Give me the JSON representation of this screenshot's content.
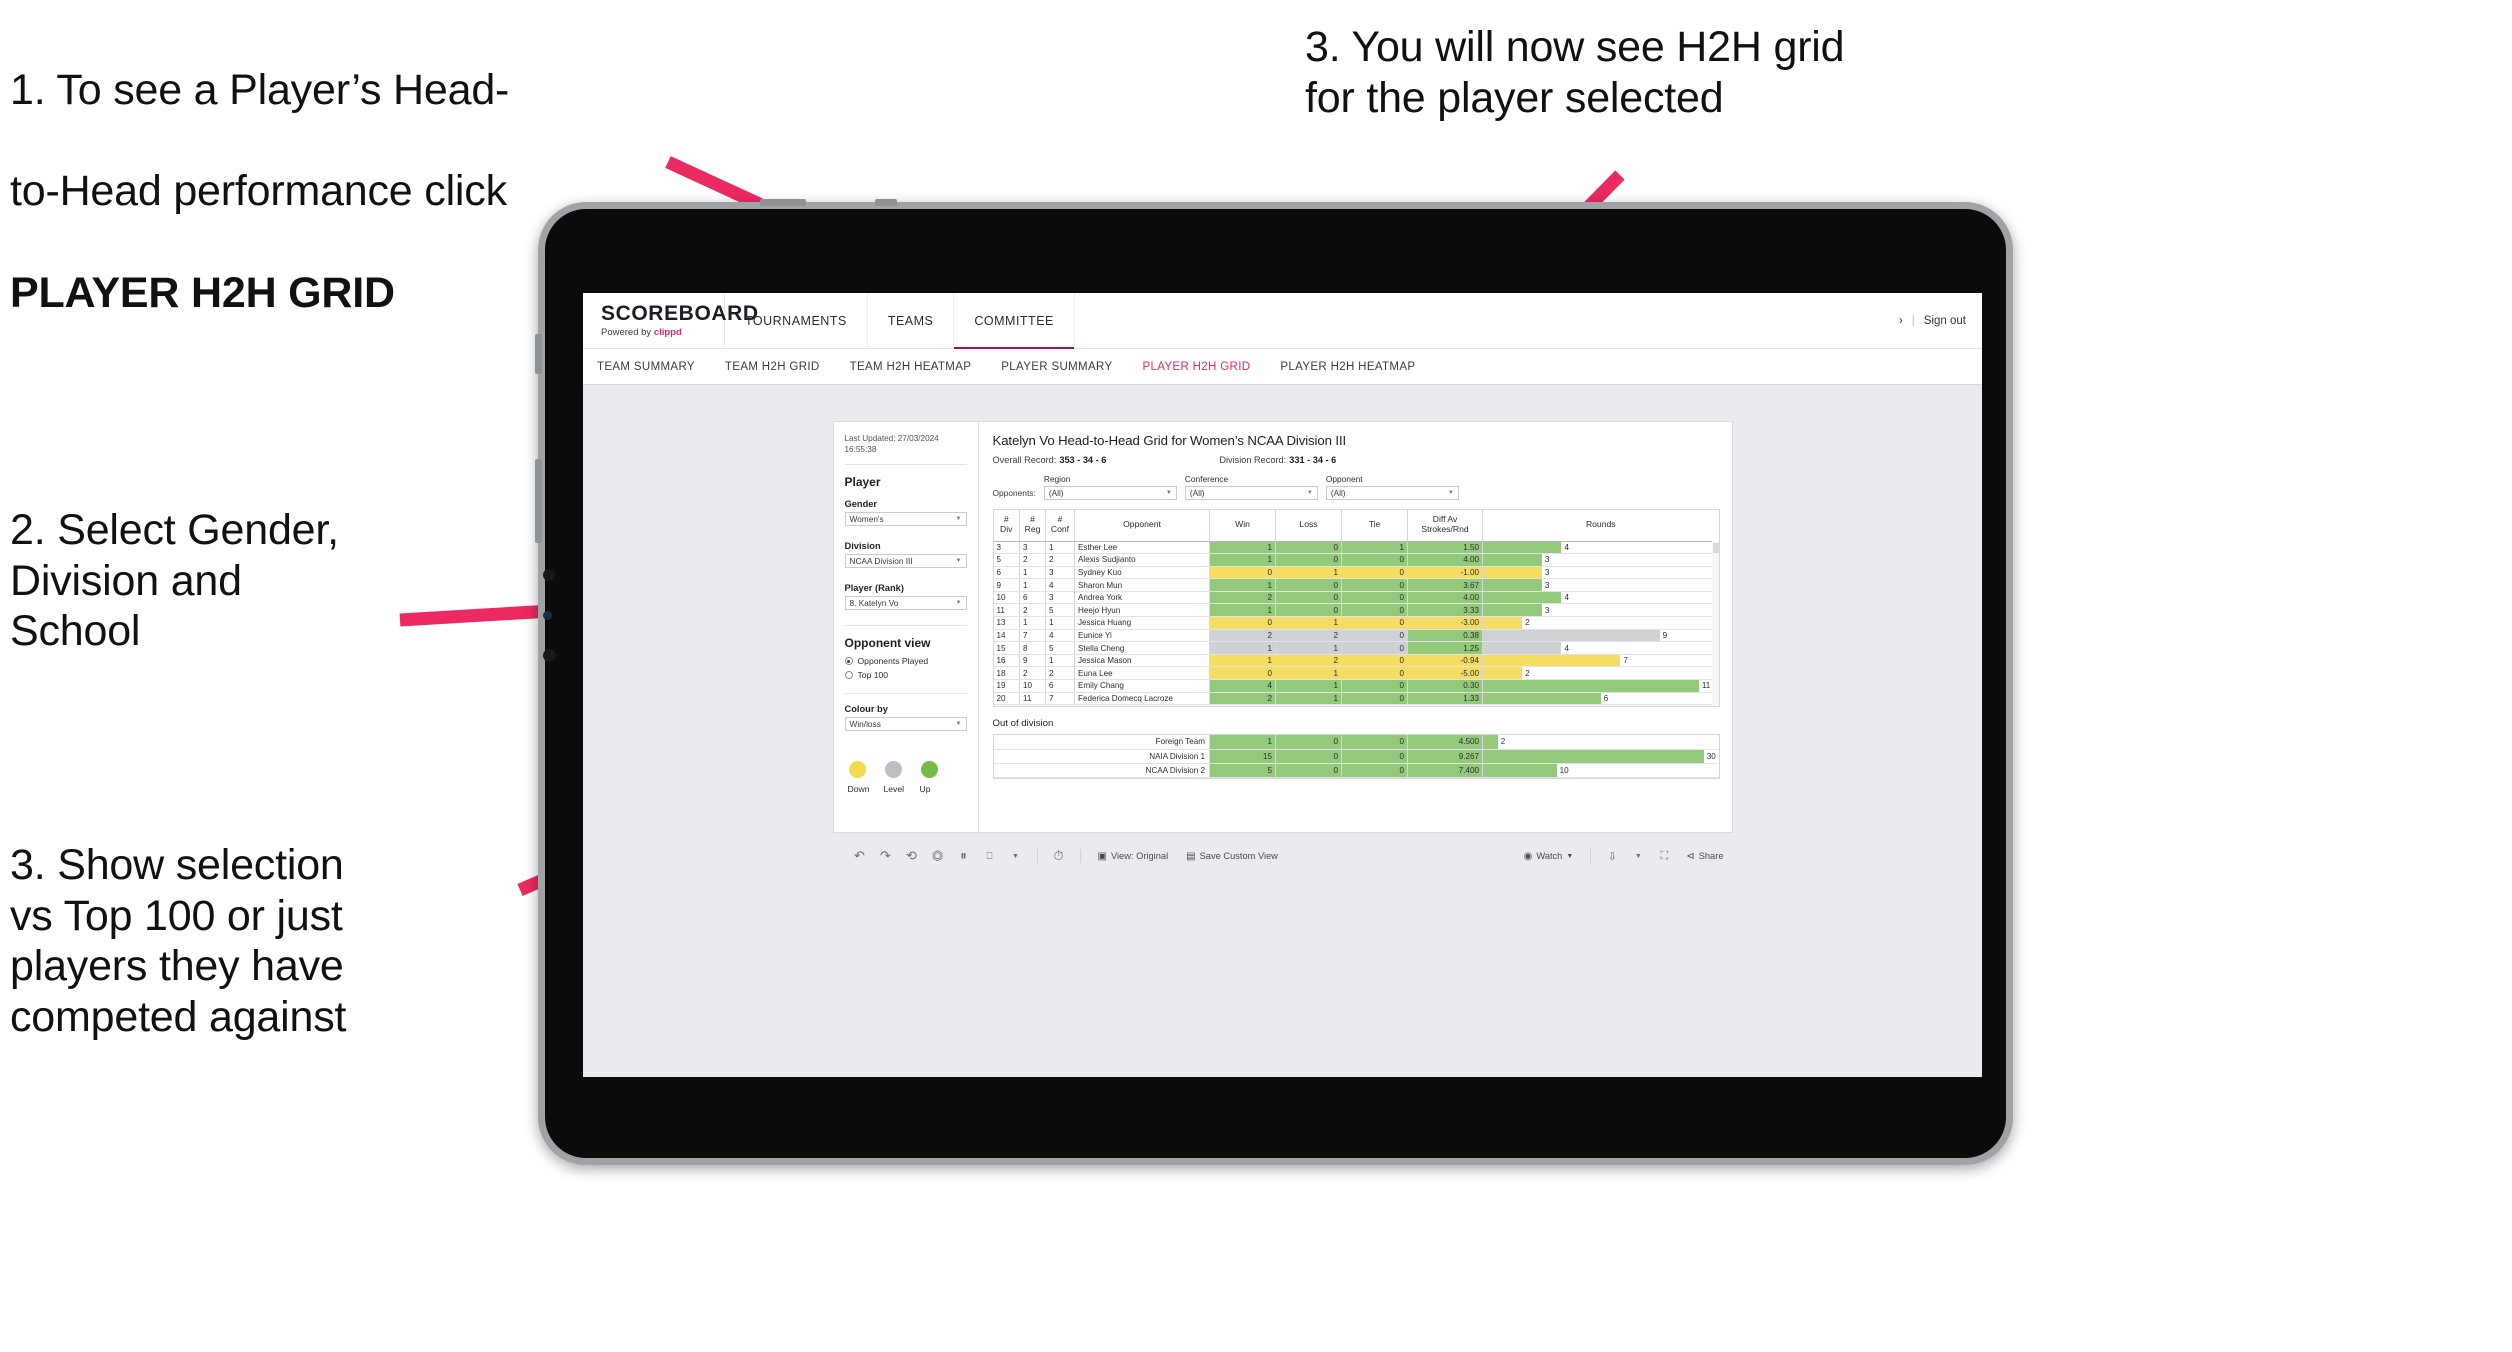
{
  "annotations": {
    "a1_line1": "1. To see a Player’s Head-",
    "a1_line2": "to-Head performance click",
    "a1_bold": "PLAYER H2H GRID",
    "a2": "2. Select Gender,\nDivision and\nSchool",
    "a3": "3. Show selection\nvs Top 100 or just\nplayers they have\ncompeted against",
    "a4": "3. You will now see H2H grid\nfor the player selected",
    "arrow_color": "#ec2a62"
  },
  "app": {
    "brand_name": "SCOREBOARD",
    "brand_sub_prefix": "Powered by ",
    "brand_sub_accent": "clippd",
    "accent_color": "#e8285f",
    "topnav": [
      {
        "label": "TOURNAMENTS"
      },
      {
        "label": "TEAMS"
      },
      {
        "label": "COMMITTEE"
      }
    ],
    "topnav_right": {
      "chevron": "›",
      "separator": "|",
      "signout": "Sign out"
    },
    "subnav": [
      {
        "label": "TEAM SUMMARY",
        "active": false
      },
      {
        "label": "TEAM H2H GRID",
        "active": false
      },
      {
        "label": "TEAM H2H HEATMAP",
        "active": false
      },
      {
        "label": "PLAYER SUMMARY",
        "active": false
      },
      {
        "label": "PLAYER H2H GRID",
        "active": true
      },
      {
        "label": "PLAYER H2H HEATMAP",
        "active": false
      }
    ]
  },
  "filters": {
    "last_updated_label": "Last Updated: 27/03/2024",
    "last_updated_time": "16:55:38",
    "player_heading": "Player",
    "gender_label": "Gender",
    "gender_value": "Women's",
    "division_label": "Division",
    "division_value": "NCAA Division III",
    "player_rank_label": "Player (Rank)",
    "player_rank_value": "8. Katelyn Vo",
    "opponent_view_heading": "Opponent view",
    "opponent_view_options": [
      {
        "label": "Opponents Played",
        "selected": true
      },
      {
        "label": "Top 100",
        "selected": false
      }
    ],
    "colour_by_label": "Colour by",
    "colour_by_value": "Win/loss",
    "legend": [
      {
        "label": "Down",
        "color": "#f2d94e"
      },
      {
        "label": "Level",
        "color": "#bcc0c2"
      },
      {
        "label": "Up",
        "color": "#76bb45"
      }
    ]
  },
  "content": {
    "title": "Katelyn Vo Head-to-Head Grid for Women’s NCAA Division III",
    "overall_record_label": "Overall Record:",
    "overall_record_value": "353 - 34 - 6",
    "division_record_label": "Division Record:",
    "division_record_value": "331 - 34 - 6",
    "opponents_label": "Opponents:",
    "opponent_filters": [
      {
        "label": "Region",
        "value": "(All)"
      },
      {
        "label": "Conference",
        "value": "(All)"
      },
      {
        "label": "Opponent",
        "value": "(All)"
      }
    ],
    "out_of_division_title": "Out of division"
  },
  "chart_data": {
    "type": "table",
    "title": "Katelyn Vo Head-to-Head Grid for Women’s NCAA Division III",
    "columns": [
      "# Div",
      "# Reg",
      "# Conf",
      "Opponent",
      "Win",
      "Loss",
      "Tie",
      "Diff Av Strokes/Rnd",
      "Rounds"
    ],
    "column_headers_multiline": [
      {
        "l1": "#",
        "l2": "Div"
      },
      {
        "l1": "#",
        "l2": "Reg"
      },
      {
        "l1": "#",
        "l2": "Conf"
      },
      {
        "l1": "Opponent",
        "l2": ""
      },
      {
        "l1": "Win",
        "l2": ""
      },
      {
        "l1": "Loss",
        "l2": ""
      },
      {
        "l1": "Tie",
        "l2": ""
      },
      {
        "l1": "Diff Av",
        "l2": "Strokes/Rnd"
      },
      {
        "l1": "Rounds",
        "l2": ""
      }
    ],
    "rounds_max": 12,
    "colors": {
      "up": "#93c97a",
      "down": "#f5dd62",
      "level": "#cfd2d4",
      "none": "#ffffff"
    },
    "rows": [
      {
        "div": "3",
        "reg": "3",
        "conf": "1",
        "opponent": "Esther Lee",
        "win": "1",
        "loss": "0",
        "tie": "1",
        "diff": "1.50",
        "rounds": "4",
        "color": "up"
      },
      {
        "div": "5",
        "reg": "2",
        "conf": "2",
        "opponent": "Alexis Sudjianto",
        "win": "1",
        "loss": "0",
        "tie": "0",
        "diff": "4.00",
        "rounds": "3",
        "color": "up"
      },
      {
        "div": "6",
        "reg": "1",
        "conf": "3",
        "opponent": "Sydney Kuo",
        "win": "0",
        "loss": "1",
        "tie": "0",
        "diff": "-1.00",
        "rounds": "3",
        "color": "down"
      },
      {
        "div": "9",
        "reg": "1",
        "conf": "4",
        "opponent": "Sharon Mun",
        "win": "1",
        "loss": "0",
        "tie": "0",
        "diff": "3.67",
        "rounds": "3",
        "color": "up"
      },
      {
        "div": "10",
        "reg": "6",
        "conf": "3",
        "opponent": "Andrea York",
        "win": "2",
        "loss": "0",
        "tie": "0",
        "diff": "4.00",
        "rounds": "4",
        "color": "up"
      },
      {
        "div": "11",
        "reg": "2",
        "conf": "5",
        "opponent": "Heejo Hyun",
        "win": "1",
        "loss": "0",
        "tie": "0",
        "diff": "3.33",
        "rounds": "3",
        "color": "up"
      },
      {
        "div": "13",
        "reg": "1",
        "conf": "1",
        "opponent": "Jessica Huang",
        "win": "0",
        "loss": "1",
        "tie": "0",
        "diff": "-3.00",
        "rounds": "2",
        "color": "down"
      },
      {
        "div": "14",
        "reg": "7",
        "conf": "4",
        "opponent": "Eunice Yi",
        "win": "2",
        "loss": "2",
        "tie": "0",
        "diff": "0.38",
        "rounds": "9",
        "color": "level",
        "diff_color": "up"
      },
      {
        "div": "15",
        "reg": "8",
        "conf": "5",
        "opponent": "Stella Cheng",
        "win": "1",
        "loss": "1",
        "tie": "0",
        "diff": "1.25",
        "rounds": "4",
        "color": "level",
        "diff_color": "up"
      },
      {
        "div": "16",
        "reg": "9",
        "conf": "1",
        "opponent": "Jessica Mason",
        "win": "1",
        "loss": "2",
        "tie": "0",
        "diff": "-0.94",
        "rounds": "7",
        "color": "down"
      },
      {
        "div": "18",
        "reg": "2",
        "conf": "2",
        "opponent": "Euna Lee",
        "win": "0",
        "loss": "1",
        "tie": "0",
        "diff": "-5.00",
        "rounds": "2",
        "color": "down"
      },
      {
        "div": "19",
        "reg": "10",
        "conf": "6",
        "opponent": "Emily Chang",
        "win": "4",
        "loss": "1",
        "tie": "0",
        "diff": "0.30",
        "rounds": "11",
        "color": "up"
      },
      {
        "div": "20",
        "reg": "11",
        "conf": "7",
        "opponent": "Federica Domecq Lacroze",
        "win": "2",
        "loss": "1",
        "tie": "0",
        "diff": "1.33",
        "rounds": "6",
        "color": "up"
      }
    ],
    "out_of_division": {
      "rounds_max": 32,
      "rows": [
        {
          "opponent": "Foreign Team",
          "win": "1",
          "loss": "0",
          "tie": "0",
          "diff": "4.500",
          "rounds": "2",
          "color": "up"
        },
        {
          "opponent": "NAIA Division 1",
          "win": "15",
          "loss": "0",
          "tie": "0",
          "diff": "9.267",
          "rounds": "30",
          "color": "up"
        },
        {
          "opponent": "NCAA Division 2",
          "win": "5",
          "loss": "0",
          "tie": "0",
          "diff": "7.400",
          "rounds": "10",
          "color": "up"
        }
      ]
    }
  },
  "toolbar": {
    "view_label": "View: Original",
    "save_label": "Save Custom View",
    "watch_label": "Watch",
    "share_label": "Share",
    "caret": "▾"
  }
}
